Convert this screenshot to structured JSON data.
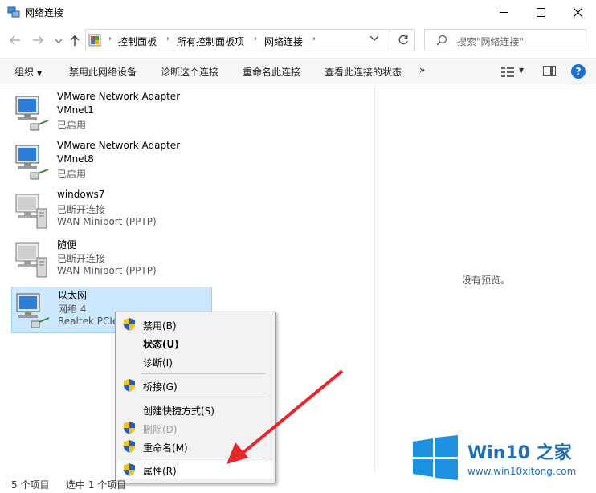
{
  "window": {
    "title": "网络连接"
  },
  "address": {
    "crumbs": [
      "控制面板",
      "所有控制面板项",
      "网络连接"
    ],
    "search_placeholder": "搜索\"网络连接\""
  },
  "toolbar": {
    "organize": "组织",
    "disable": "禁用此网络设备",
    "diagnose": "诊断这个连接",
    "rename": "重命名此连接",
    "status": "查看此连接的状态",
    "more": "»"
  },
  "items": [
    {
      "name": "VMware Network Adapter",
      "line2": "VMnet1",
      "line3": "已启用"
    },
    {
      "name": "VMware Network Adapter",
      "line2": "VMnet8",
      "line3": "已启用"
    },
    {
      "name": "windows7",
      "line2": "已断开连接",
      "line3": "WAN Miniport (PPTP)"
    },
    {
      "name": "随便",
      "line2": "已断开连接",
      "line3": "WAN Miniport (PPTP)"
    },
    {
      "name": "以太网",
      "line2": "网络 4",
      "line3": "Realtek PCIe"
    }
  ],
  "preview": {
    "empty_text": "没有预览。"
  },
  "context_menu": {
    "disable": "禁用(B)",
    "status": "状态(U)",
    "diagnose": "诊断(I)",
    "bridge": "桥接(G)",
    "shortcut": "创建快捷方式(S)",
    "delete": "删除(D)",
    "rename": "重命名(M)",
    "properties": "属性(R)"
  },
  "statusbar": {
    "count": "5 个项目",
    "selected": "选中 1 个项目"
  },
  "watermark": {
    "title": "Win10 之家",
    "url": "www.win10xitong.com"
  },
  "colors": {
    "accent": "#1f6fd1",
    "selection": "#cce8ff",
    "arrow": "#e8262a"
  }
}
